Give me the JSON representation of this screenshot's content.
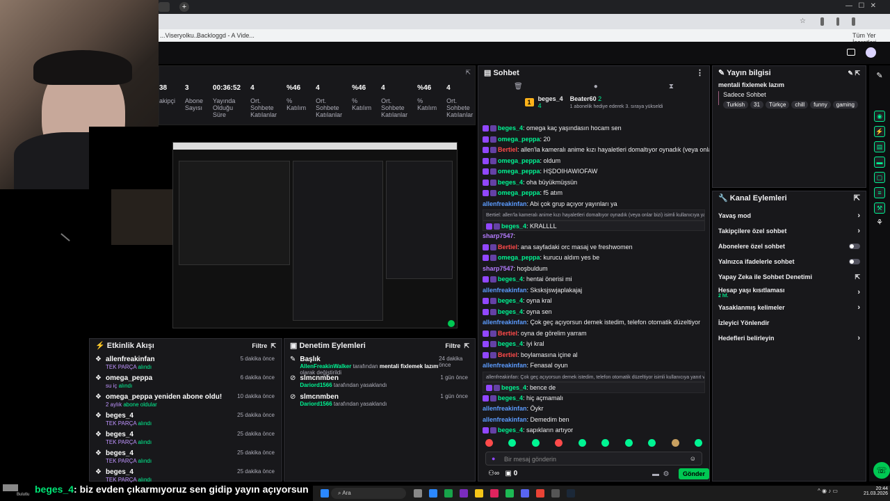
{
  "browser": {
    "bookmarks": [
      "...Viseryolku...",
      "Backloggd - A Vide...",
      "Tüm Yer İşaretleri"
    ]
  },
  "stats": [
    {
      "value": "38",
      "label": "akipçi"
    },
    {
      "value": "3",
      "label": "Abone Sayısı"
    },
    {
      "value": "00:36:52",
      "label": "Yayında Olduğu Süre"
    },
    {
      "value": "4",
      "label": "Ort. Sohbete Katılanlar"
    },
    {
      "value": "%46",
      "label": "% Katılım"
    },
    {
      "value": "4",
      "label": "Ort. Sohbete Katılanlar"
    },
    {
      "value": "%46",
      "label": "% Katılım"
    },
    {
      "value": "4",
      "label": "Ort. Sohbete Katılanlar"
    },
    {
      "value": "%46",
      "label": "% Katılım"
    },
    {
      "value": "4",
      "label": "Ort. Sohbete Katılanlar"
    },
    {
      "value": "%46",
      "label": "% Katılım"
    }
  ],
  "activity": {
    "title": "Etkinlik Akışı",
    "filter": "Filtre",
    "items": [
      {
        "name": "allenfreakinfan",
        "sub": "TEK PARÇA",
        "sub2": "alındı",
        "time": "5 dakika önce"
      },
      {
        "name": "omega_peppa",
        "sub": "su iç",
        "sub2": "alındı",
        "time": "6 dakika önce"
      },
      {
        "name": "omega_peppa yeniden abone oldu!",
        "sub": "2 aylık",
        "sub2": "abone oldular",
        "time": "10 dakika önce"
      },
      {
        "name": "beges_4",
        "sub": "TEK PARÇA",
        "sub2": "alındı",
        "time": "25 dakika önce"
      },
      {
        "name": "beges_4",
        "sub": "TEK PARÇA",
        "sub2": "alındı",
        "time": "25 dakika önce"
      },
      {
        "name": "beges_4",
        "sub": "TEK PARÇA",
        "sub2": "alındı",
        "time": "25 dakika önce"
      },
      {
        "name": "beges_4",
        "sub": "TEK PARÇA",
        "sub2": "alındı",
        "time": "25 dakika önce"
      }
    ]
  },
  "moderation": {
    "title": "Denetim Eylemleri",
    "filter": "Filtre",
    "items": [
      {
        "name": "Başlık",
        "by": "AllenFreakinWalker",
        "text": "tarafından",
        "extra": "mentali fixlemek lazım",
        "extra2": "olarak değiştirildi",
        "time": "24 dakika önce"
      },
      {
        "name": "slmcnmben",
        "by": "Dariord1566",
        "text": "tarafından yasaklandı",
        "extra": "",
        "extra2": "",
        "time": "1 gün önce"
      },
      {
        "name": "slmcnmben",
        "by": "Dariord1566",
        "text": "tarafından yasaklandı",
        "extra": "",
        "extra2": "",
        "time": "1 gün önce"
      }
    ]
  },
  "chat": {
    "title": "Sohbet",
    "pinned": {
      "user": "beges_4",
      "count": "4",
      "gift_user": "Beater60",
      "gift_count": "2",
      "gift_text": "1 abonelik hediye ederek 3. sıraya yükseldi"
    },
    "messages": [
      {
        "user": "beges_4",
        "cls": "u-green",
        "text": "omega kaç yaşındasın hocam sen",
        "hl": false
      },
      {
        "user": "omega_peppa",
        "cls": "u-green",
        "text": "20",
        "hl": false
      },
      {
        "user": "Bertiel",
        "cls": "u-red",
        "text": "allen'la kameralı anime kızı hayaletleri domaltıyor oynadık (veya onlar bizi)",
        "hl": false
      },
      {
        "user": "omega_peppa",
        "cls": "u-green",
        "text": "oldum",
        "hl": false
      },
      {
        "user": "omega_peppa",
        "cls": "u-green",
        "text": "HŞDOIHAWIOFAW",
        "hl": false
      },
      {
        "user": "beges_4",
        "cls": "u-green",
        "text": "oha büyükmüşsün",
        "hl": false
      },
      {
        "user": "omega_peppa",
        "cls": "u-green",
        "text": "f5 atım",
        "hl": false
      },
      {
        "user": "allenfreakinfan",
        "cls": "u-blue",
        "text": "Abi çok grup açıyor yayınları ya",
        "hl": false
      },
      {
        "user": "",
        "cls": "",
        "text": "Bertiel: allen'la kameralı anime kızı hayaletleri domaltıyor oynadık (veya onlar bizi) isimli kullanıcıya yanıt ver",
        "hl": true
      },
      {
        "user": "beges_4",
        "cls": "u-green",
        "text": "KRALLLL",
        "hl": true
      },
      {
        "user": "sharp7547",
        "cls": "u-purple",
        "text": "",
        "hl": false
      },
      {
        "user": "Bertiel",
        "cls": "u-red",
        "text": "ana sayfadaki orc masaj ve freshwomen",
        "hl": false
      },
      {
        "user": "omega_peppa",
        "cls": "u-green",
        "text": "kurucu aldım yes be",
        "hl": false
      },
      {
        "user": "sharp7547",
        "cls": "u-purple",
        "text": "hoşbuldum",
        "hl": false
      },
      {
        "user": "beges_4",
        "cls": "u-green",
        "text": "hentai önerisi mi",
        "hl": false
      },
      {
        "user": "allenfreakinfan",
        "cls": "u-blue",
        "text": "Sksksjswjaplakajaj",
        "hl": false
      },
      {
        "user": "beges_4",
        "cls": "u-green",
        "text": "oyna kral",
        "hl": false
      },
      {
        "user": "beges_4",
        "cls": "u-green",
        "text": "oyna sen",
        "hl": false
      },
      {
        "user": "allenfreakinfan",
        "cls": "u-blue",
        "text": "Çok geç açıyorsun demek istedim, telefon otomatik düzeltiyor",
        "hl": false
      },
      {
        "user": "Bertiel",
        "cls": "u-red",
        "text": "oyna de görelim yarram",
        "hl": false
      },
      {
        "user": "beges_4",
        "cls": "u-green",
        "text": "iyi kral",
        "hl": false
      },
      {
        "user": "Bertiel",
        "cls": "u-red",
        "text": "boylamasına içine al",
        "hl": false
      },
      {
        "user": "allenfreakinfan",
        "cls": "u-blue",
        "text": "Fenasal oyun",
        "hl": false
      },
      {
        "user": "",
        "cls": "",
        "text": "allenfreakinfan: Çok geç açıyorsun demek istedim, telefon otomatik düzeltiyor isimli kullanıcıya yanıt ver",
        "hl": true
      },
      {
        "user": "beges_4",
        "cls": "u-green",
        "text": "bence de",
        "hl": true
      },
      {
        "user": "beges_4",
        "cls": "u-green",
        "text": "hiç açmamalı",
        "hl": false
      },
      {
        "user": "allenfreakinfan",
        "cls": "u-blue",
        "text": "Öykr",
        "hl": false
      },
      {
        "user": "allenfreakinfan",
        "cls": "u-blue",
        "text": "Demedim ben",
        "hl": false
      },
      {
        "user": "beges_4",
        "cls": "u-green",
        "text": "sapıkların artıyor",
        "hl": false
      },
      {
        "user": "beges_4",
        "cls": "u-green",
        "text": "biz evden çıkarmıyoruz sen gidip yayın açıyorsun",
        "hl": false
      }
    ],
    "input_placeholder": "Bir mesaj gönderin",
    "points": "0",
    "send": "Gönder"
  },
  "stream_info": {
    "title": "Yayın bilgisi",
    "stream_title": "mentali fixlemek lazım",
    "category": "Sadece Sohbet",
    "tags": [
      "Turkish",
      "31",
      "Türkçe",
      "chill",
      "funny",
      "gaming"
    ]
  },
  "channel_actions": {
    "title": "Kanal Eylemleri",
    "items": [
      {
        "label": "Yavaş mod",
        "kind": "arrow",
        "sub": ""
      },
      {
        "label": "Takipçilere özel sohbet",
        "kind": "arrow",
        "sub": ""
      },
      {
        "label": "Abonelere özel sohbet",
        "kind": "toggle",
        "sub": ""
      },
      {
        "label": "Yalnızca ifadelerle sohbet",
        "kind": "toggle",
        "sub": ""
      },
      {
        "label": "Yapay Zeka ile Sohbet Denetimi",
        "kind": "ext",
        "sub": ""
      },
      {
        "label": "Hesap yaşı kısıtlaması",
        "kind": "arrow",
        "sub": "2 hf."
      },
      {
        "label": "Yasaklanmış kelimeler",
        "kind": "arrow",
        "sub": ""
      },
      {
        "label": "İzleyici Yönlendir",
        "kind": "none",
        "sub": ""
      },
      {
        "label": "Hedefleri belirleyin",
        "kind": "arrow",
        "sub": ""
      }
    ]
  },
  "overlay": {
    "user": "beges_4",
    "text": ": biz evden çıkarmıyoruz sen gidip yayın açıyorsun",
    "bottom_label": "Bulutlu"
  },
  "taskbar": {
    "search": "Ara",
    "time": "20:44",
    "date": "21.03.2026"
  }
}
